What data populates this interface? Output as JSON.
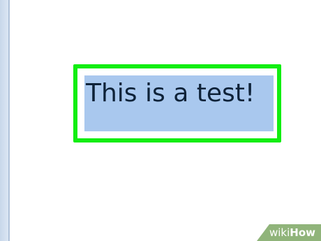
{
  "document": {
    "selected_text": "This is a test!"
  },
  "watermark": {
    "part1": "wiki",
    "part2": "How"
  },
  "colors": {
    "highlight_border": "#11ee11",
    "selection": "#a9c8ee",
    "text": "#0e2238",
    "watermark_bg": "#90b47a"
  }
}
